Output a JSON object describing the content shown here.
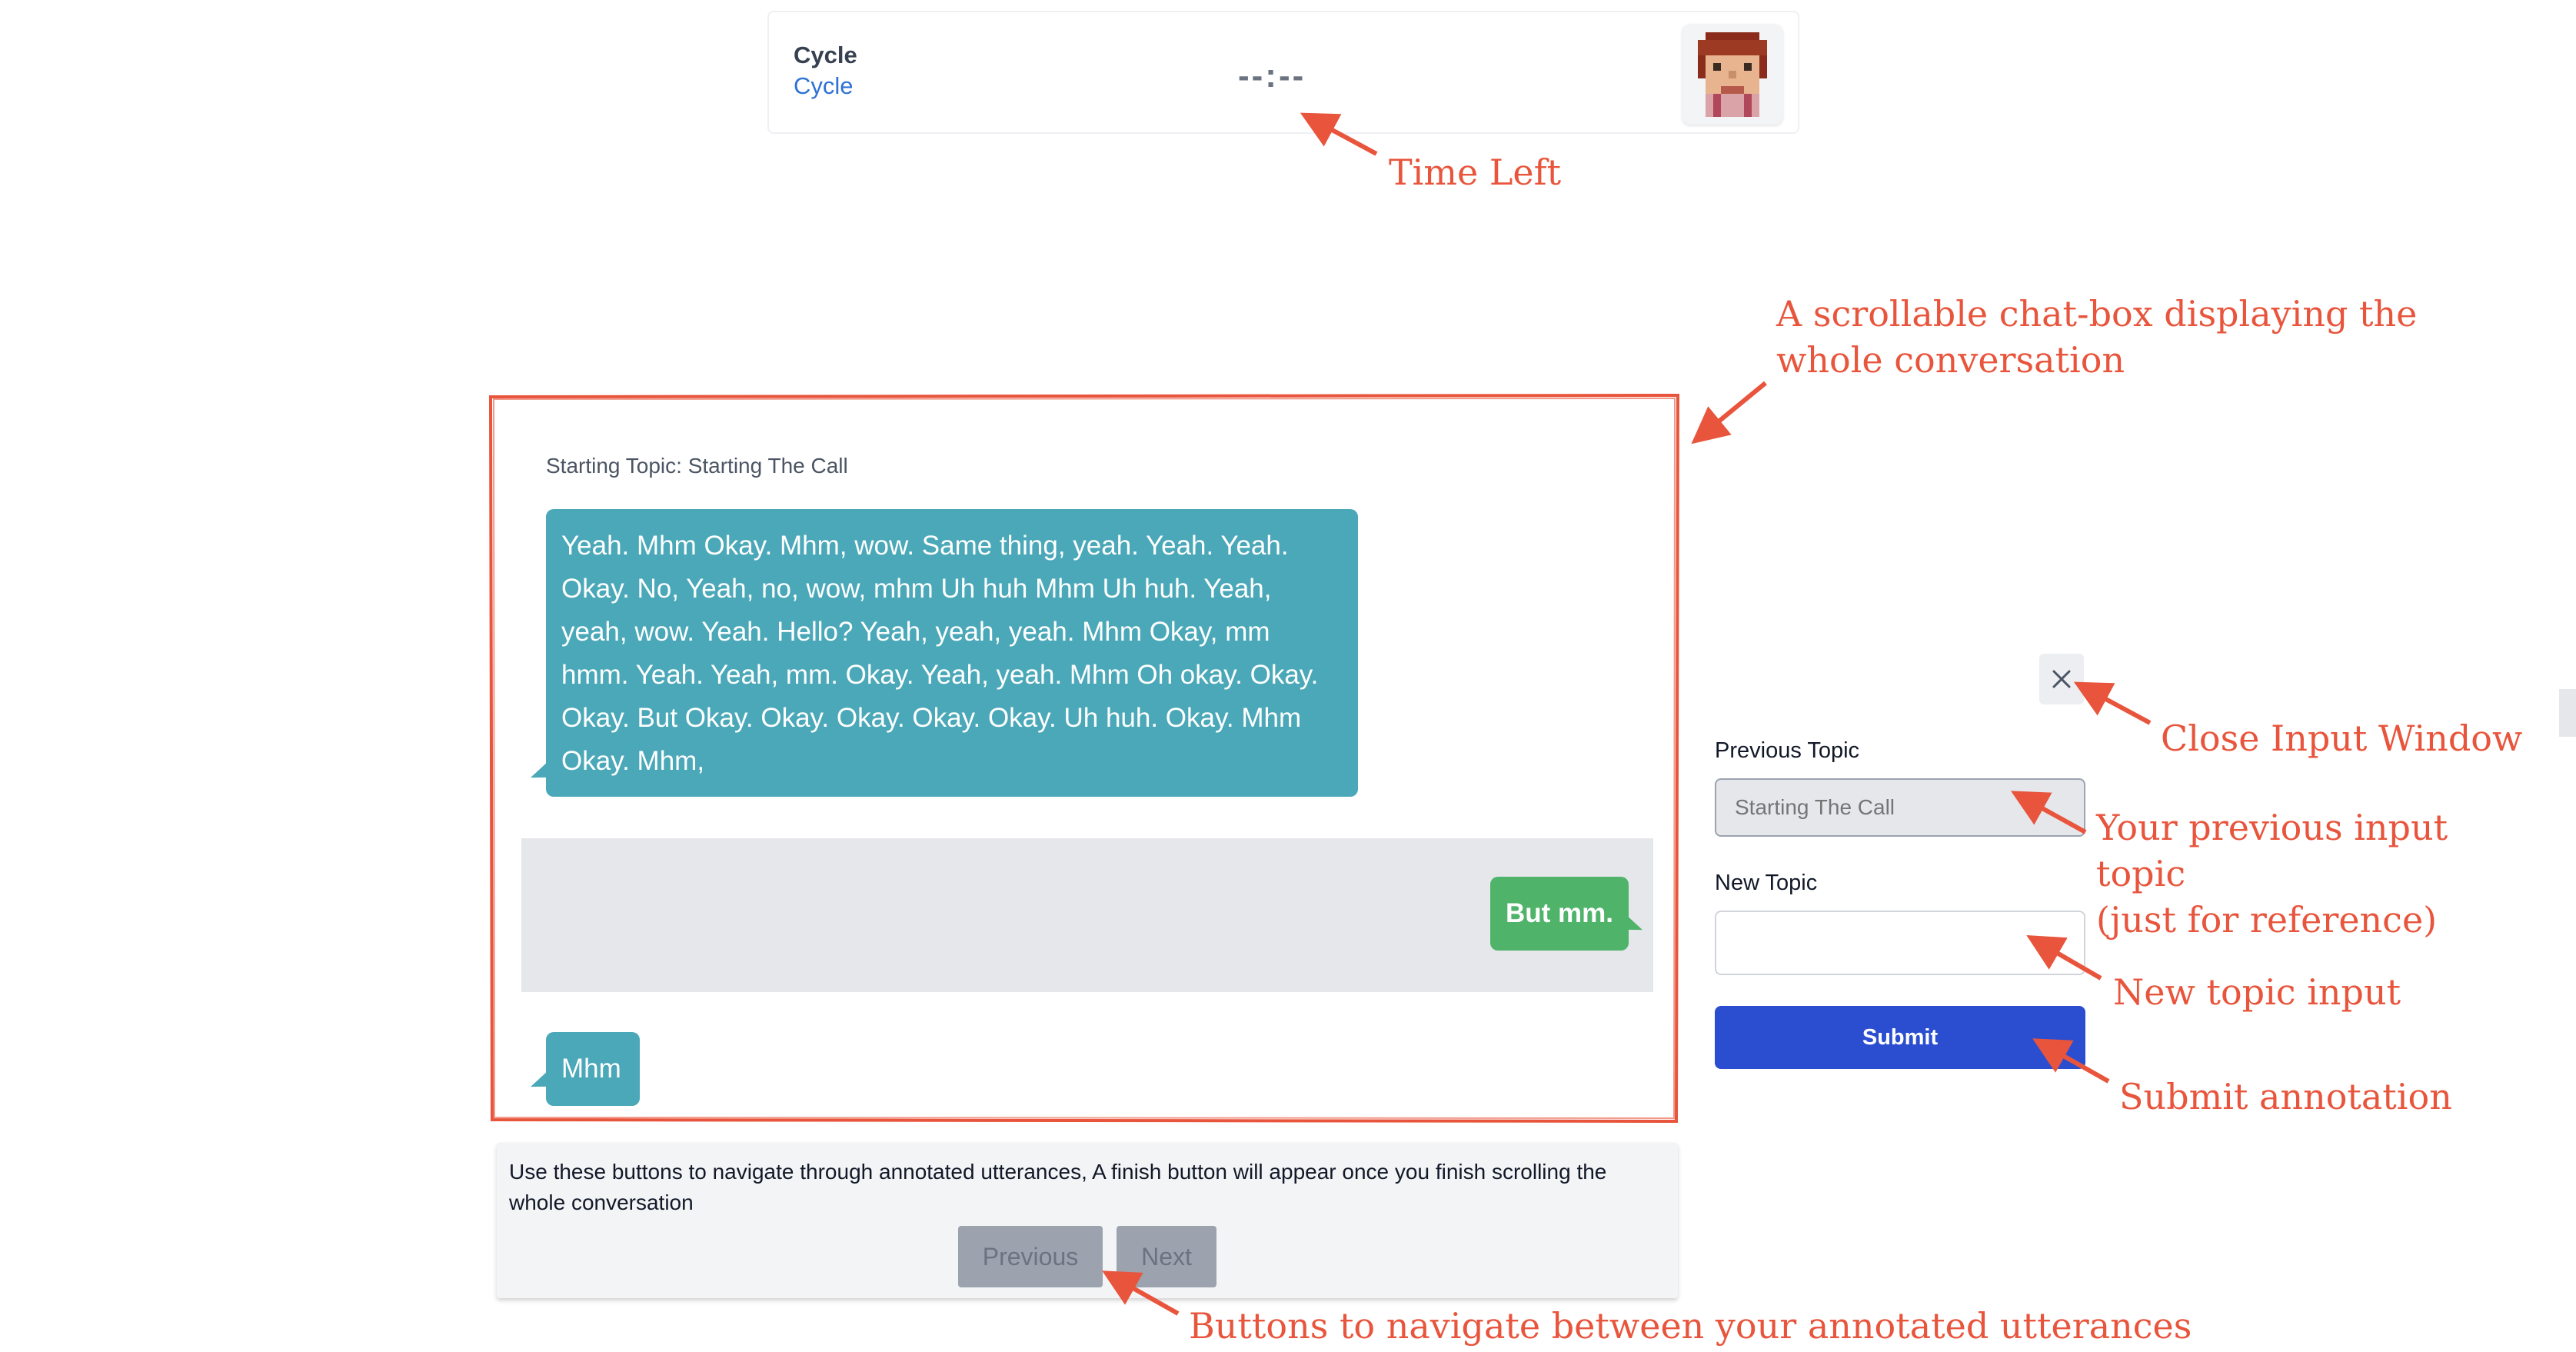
{
  "header": {
    "title": "Cycle",
    "subtitle": "Cycle",
    "timer": "--:--"
  },
  "chat": {
    "starting_topic_label": "Starting Topic: Starting The Call",
    "messages": [
      {
        "side": "left",
        "text": "Yeah. Mhm Okay. Mhm, wow. Same thing, yeah. Yeah. Yeah. Okay. No, Yeah, no, wow, mhm Uh huh Mhm Uh huh. Yeah, yeah, wow. Yeah. Hello? Yeah, yeah, yeah. Mhm Okay, mm hmm. Yeah. Yeah, mm. Okay. Yeah, yeah. Mhm Oh okay. Okay. Okay. But Okay. Okay. Okay. Okay. Okay. Uh huh. Okay. Mhm Okay. Mhm,"
      },
      {
        "side": "right",
        "text": "But mm.",
        "highlighted": true
      },
      {
        "side": "left",
        "text": "Mhm"
      }
    ]
  },
  "navigation": {
    "help_text": "Use these buttons to navigate through annotated utterances, A finish button will appear once you finish scrolling the whole conversation",
    "previous_label": "Previous",
    "next_label": "Next"
  },
  "annotation_panel": {
    "close_icon": "close-icon",
    "previous_topic_label": "Previous Topic",
    "previous_topic_placeholder": "Starting The Call",
    "new_topic_label": "New Topic",
    "new_topic_value": "",
    "submit_label": "Submit"
  },
  "callouts": {
    "time_left": "Time Left",
    "chat_line1": "A scrollable chat-box displaying the",
    "chat_line2": "whole conversation",
    "close": "Close Input Window",
    "prev_line1": "Your previous input",
    "prev_line2": "topic",
    "prev_line3": "(just for reference)",
    "new_topic": "New topic input",
    "submit": "Submit annotation",
    "nav": "Buttons to navigate between your annotated utterances"
  },
  "colors": {
    "annotation_red": "#e8553c",
    "bubble_teal": "#4aa8b8",
    "bubble_green": "#4fb36a",
    "submit_blue": "#2b4ed0"
  }
}
